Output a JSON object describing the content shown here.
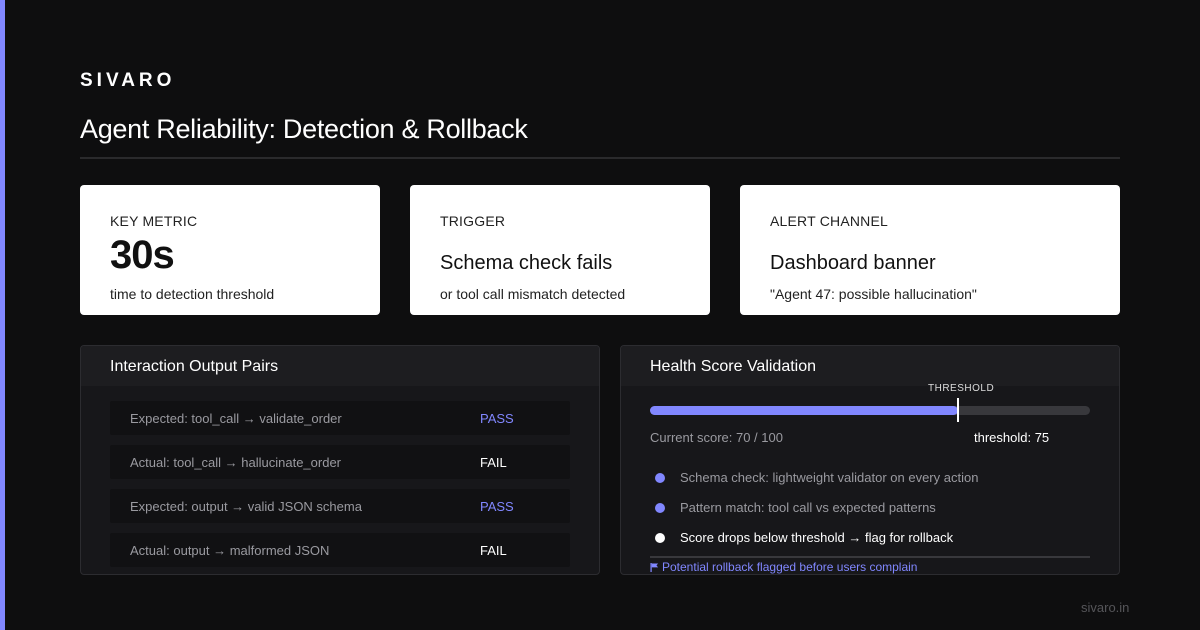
{
  "brand": "SIVARO",
  "title": "Agent Reliability: Detection & Rollback",
  "cards": [
    {
      "label": "KEY METRIC",
      "value": "30s",
      "sub": "time to detection threshold"
    },
    {
      "label": "TRIGGER",
      "value": "Schema check fails",
      "sub": "or tool call mismatch detected"
    },
    {
      "label": "ALERT CHANNEL",
      "value": "Dashboard banner",
      "sub": "\"Agent 47: possible hallucination\""
    }
  ],
  "pairs_panel": {
    "title": "Interaction Output Pairs",
    "rows": [
      {
        "text": "Expected: tool_call → validate_order",
        "status": "PASS"
      },
      {
        "text": "Actual: tool_call → hallucinate_order",
        "status": "FAIL"
      },
      {
        "text": "Expected: output → valid JSON schema",
        "status": "PASS"
      },
      {
        "text": "Actual: output → malformed JSON",
        "status": "FAIL"
      }
    ]
  },
  "health_panel": {
    "title": "Health Score Validation",
    "threshold_label": "THRESHOLD",
    "score": 70,
    "score_max": 100,
    "threshold": 75,
    "score_text": "Current score: 70 / 100",
    "threshold_text": "threshold: 75",
    "bullets": [
      {
        "text": "Schema check: lightweight validator on every action",
        "dot": "#8187ff",
        "color": "#9a9aa0"
      },
      {
        "text": "Pattern match: tool call vs expected patterns",
        "dot": "#8187ff",
        "color": "#9a9aa0"
      },
      {
        "text": "Score drops below threshold → flag for rollback",
        "dot": "#ffffff",
        "color": "#ffffff"
      }
    ],
    "callout": "Potential rollback flagged before users complain",
    "callout_icon": "flag-icon"
  },
  "footer_url": "sivaro.in",
  "colors": {
    "accent": "#8187ff",
    "background": "#0e0e0f",
    "card": "#ffffff",
    "panel": "#17171a"
  }
}
